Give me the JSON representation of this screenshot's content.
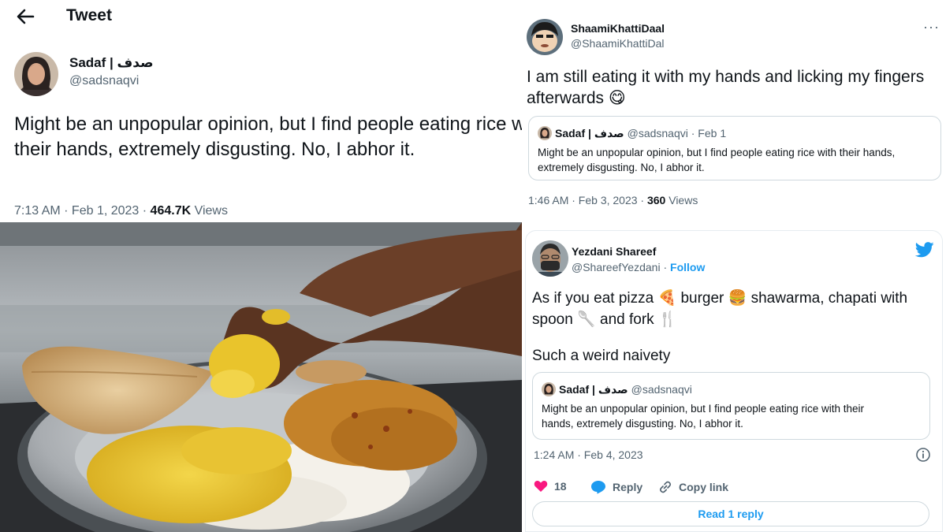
{
  "left_tweet": {
    "header_title": "Tweet",
    "author_name": "Sadaf | صدف",
    "author_handle": "@sadsnaqvi",
    "text": "Might be an unpopular opinion, but I find people eating rice with their hands, extremely disgusting. No, I abhor it.",
    "time": "7:13 AM · Feb 1, 2023 · ",
    "views_count": "464.7K",
    "views_label": " Views"
  },
  "tweet_a": {
    "author_name": "ShaamiKhattiDaal",
    "author_handle": "@ShaamiKhattiDal",
    "more": "···",
    "text": "I am still eating it with my hands and licking my fingers afterwards",
    "emoji": "😋",
    "quote": {
      "name": "Sadaf | صدف",
      "handle_date": "@sadsnaqvi · Feb 1",
      "text_line1": "Might be an unpopular opinion, but I find people eating rice with their hands,",
      "text_line2": "extremely disgusting. No, I abhor it."
    },
    "time": "1:46 AM · Feb 3, 2023 · ",
    "views_count": "360",
    "views_label": " Views"
  },
  "tweet_b": {
    "author_name": "Yezdani Shareef",
    "author_handle": "@ShareefYezdani",
    "separator": " · ",
    "follow_label": "Follow",
    "text_part1": "As if you eat pizza",
    "emoji_pizza": "🍕",
    "text_part2": "burger",
    "emoji_burger": "🍔",
    "text_part3": "shawarma, chapati with spoon",
    "emoji_spoon": "🥄",
    "text_part4": "and fork",
    "emoji_fork": "🍴",
    "text2": "Such a weird naivety",
    "quote": {
      "name": "Sadaf | صدف",
      "handle": "@sadsnaqvi",
      "text_line1": "Might be an unpopular opinion, but I find people eating rice with their",
      "text_line2": "hands, extremely disgusting. No, I abhor it."
    },
    "time": "1:24 AM · Feb 4, 2023",
    "likes": "18",
    "reply_label": "Reply",
    "copy_link_label": "Copy link",
    "read_reply_label": "Read 1 reply"
  },
  "colors": {
    "accent": "#1d9bf0",
    "like": "#f91880",
    "muted": "#536471",
    "text": "#0f1419"
  }
}
